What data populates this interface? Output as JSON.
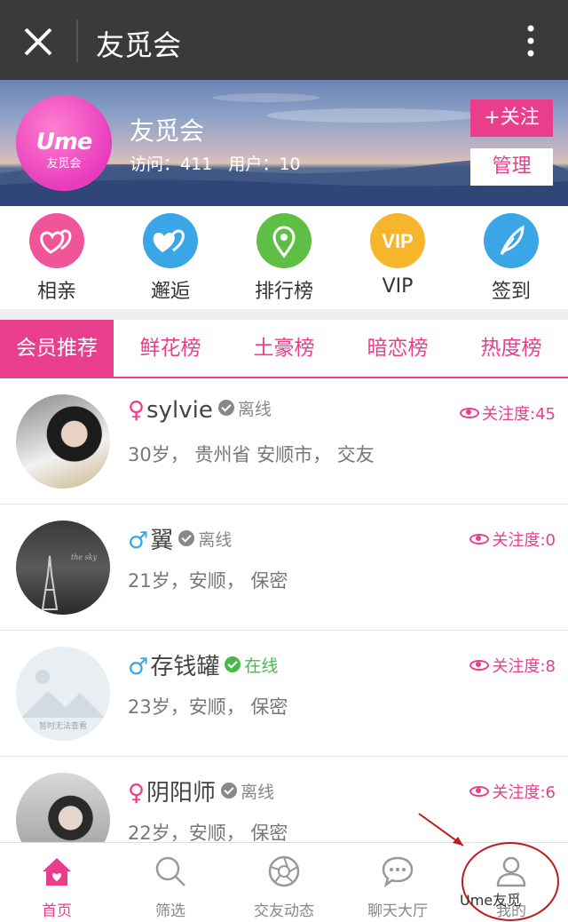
{
  "topbar": {
    "title": "友觅会"
  },
  "banner": {
    "logo_text": "Ume",
    "logo_sub": "友觅会",
    "name": "友觅会",
    "visits": "访问：411",
    "users": "用户：10",
    "follow_label": "+关注",
    "manage_label": "管理"
  },
  "features": [
    {
      "label": "相亲",
      "icon": "heart-double-icon",
      "color": "#f0559a"
    },
    {
      "label": "邂逅",
      "icon": "heart-double-icon",
      "color": "#3aa6e6"
    },
    {
      "label": "排行榜",
      "icon": "location-pin-icon",
      "color": "#5fbf45"
    },
    {
      "label": "VIP",
      "icon": "vip-icon",
      "color": "#f6b52b"
    },
    {
      "label": "签到",
      "icon": "feather-icon",
      "color": "#3aa6e6"
    }
  ],
  "tabs": [
    "会员推荐",
    "鲜花榜",
    "土豪榜",
    "暗恋榜",
    "热度榜"
  ],
  "members": [
    {
      "sex": "♀",
      "sex_color": "#e83e8c",
      "name": "sylvie",
      "status": "离线",
      "status_color": "#888888",
      "info": "30岁， 贵州省 安顺市， 交友",
      "heat": "关注度:45"
    },
    {
      "sex": "♂",
      "sex_color": "#3aa6e6",
      "name": "翼",
      "status": "离线",
      "status_color": "#888888",
      "info": "21岁，安顺， 保密",
      "heat": "关注度:0"
    },
    {
      "sex": "♂",
      "sex_color": "#3aa6e6",
      "name": "存钱罐",
      "status": "在线",
      "status_color": "#4cb84c",
      "info": "23岁，安顺， 保密",
      "heat": "关注度:8",
      "avatar_placeholder": "暂时无法查看"
    },
    {
      "sex": "♀",
      "sex_color": "#e83e8c",
      "name": "阴阳师",
      "status": "离线",
      "status_color": "#888888",
      "info": "22岁，安顺， 保密",
      "heat": "关注度:6"
    }
  ],
  "bottom_nav": [
    {
      "label": "首页",
      "icon": "home-icon",
      "active": true
    },
    {
      "label": "筛选",
      "icon": "search-icon",
      "active": false
    },
    {
      "label": "交友动态",
      "icon": "aperture-icon",
      "active": false
    },
    {
      "label": "聊天大厅",
      "icon": "chat-bubble-icon",
      "active": false
    },
    {
      "label": "我的",
      "icon": "user-icon",
      "active": false
    }
  ],
  "watermark": "Ume友觅",
  "colors": {
    "accent": "#e83e8c",
    "topbar": "#3a3a3c"
  }
}
